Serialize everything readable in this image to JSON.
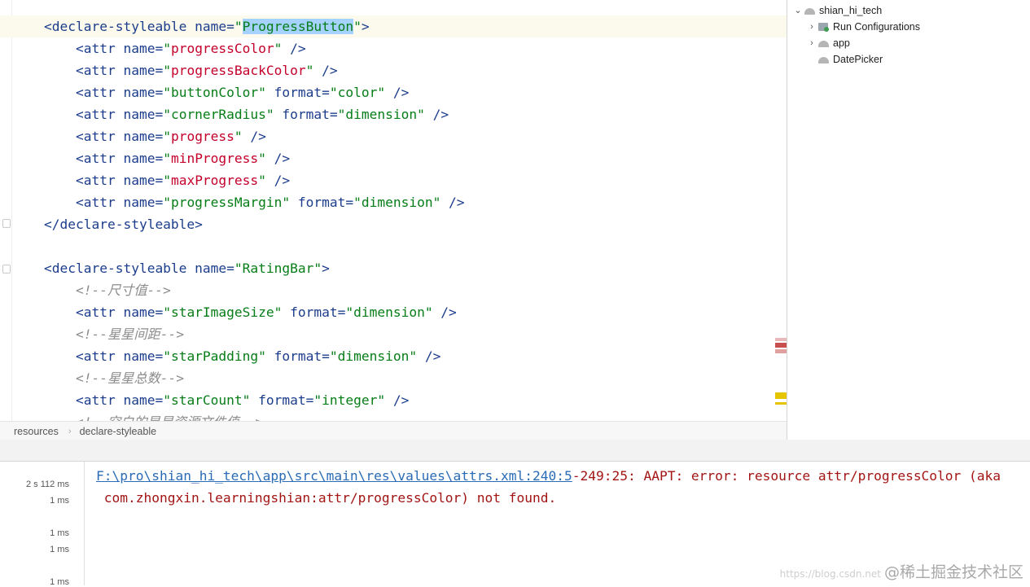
{
  "editor": {
    "lines": [
      {
        "tokens": [
          [
            "tag",
            "<declare-styleable "
          ],
          [
            "attr",
            "name="
          ],
          [
            "val-sel-pre",
            "\""
          ],
          [
            "sel",
            "ProgressButton"
          ],
          [
            "val",
            "\""
          ],
          [
            "tag",
            ">"
          ]
        ]
      },
      {
        "tokens": [
          [
            "tag",
            "    <attr "
          ],
          [
            "attr",
            "name="
          ],
          [
            "val",
            "\""
          ],
          [
            "valr",
            "progressColor"
          ],
          [
            "val",
            "\""
          ],
          [
            "tag",
            " />"
          ]
        ]
      },
      {
        "tokens": [
          [
            "tag",
            "    <attr "
          ],
          [
            "attr",
            "name="
          ],
          [
            "val",
            "\""
          ],
          [
            "valr",
            "progressBackColor"
          ],
          [
            "val",
            "\""
          ],
          [
            "tag",
            " />"
          ]
        ]
      },
      {
        "tokens": [
          [
            "tag",
            "    <attr "
          ],
          [
            "attr",
            "name="
          ],
          [
            "val",
            "\"buttonColor\""
          ],
          [
            "attr",
            " format="
          ],
          [
            "val",
            "\"color\""
          ],
          [
            "tag",
            " />"
          ]
        ]
      },
      {
        "tokens": [
          [
            "tag",
            "    <attr "
          ],
          [
            "attr",
            "name="
          ],
          [
            "val",
            "\"cornerRadius\""
          ],
          [
            "attr",
            " format="
          ],
          [
            "val",
            "\"dimension\""
          ],
          [
            "tag",
            " />"
          ]
        ]
      },
      {
        "tokens": [
          [
            "tag",
            "    <attr "
          ],
          [
            "attr",
            "name="
          ],
          [
            "val",
            "\""
          ],
          [
            "valr",
            "progress"
          ],
          [
            "val",
            "\""
          ],
          [
            "tag",
            " />"
          ]
        ]
      },
      {
        "tokens": [
          [
            "tag",
            "    <attr "
          ],
          [
            "attr",
            "name="
          ],
          [
            "val",
            "\""
          ],
          [
            "valr",
            "minProgress"
          ],
          [
            "val",
            "\""
          ],
          [
            "tag",
            " />"
          ]
        ]
      },
      {
        "tokens": [
          [
            "tag",
            "    <attr "
          ],
          [
            "attr",
            "name="
          ],
          [
            "val",
            "\""
          ],
          [
            "valr",
            "maxProgress"
          ],
          [
            "val",
            "\""
          ],
          [
            "tag",
            " />"
          ]
        ]
      },
      {
        "tokens": [
          [
            "tag",
            "    <attr "
          ],
          [
            "attr",
            "name="
          ],
          [
            "val",
            "\"progressMargin\""
          ],
          [
            "attr",
            " format="
          ],
          [
            "val",
            "\"dimension\""
          ],
          [
            "tag",
            " />"
          ]
        ]
      },
      {
        "tokens": [
          [
            "tag",
            "</declare-styleable>"
          ]
        ]
      },
      {
        "tokens": []
      },
      {
        "tokens": [
          [
            "tag",
            "<declare-styleable "
          ],
          [
            "attr",
            "name="
          ],
          [
            "val",
            "\"RatingBar\""
          ],
          [
            "tag",
            ">"
          ]
        ]
      },
      {
        "tokens": [
          [
            "com",
            "    <!--尺寸值-->"
          ]
        ]
      },
      {
        "tokens": [
          [
            "tag",
            "    <attr "
          ],
          [
            "attr",
            "name="
          ],
          [
            "val",
            "\"starImageSize\""
          ],
          [
            "attr",
            " format="
          ],
          [
            "val",
            "\"dimension\""
          ],
          [
            "tag",
            " />"
          ]
        ]
      },
      {
        "tokens": [
          [
            "com",
            "    <!--星星间距-->"
          ]
        ]
      },
      {
        "tokens": [
          [
            "tag",
            "    <attr "
          ],
          [
            "attr",
            "name="
          ],
          [
            "val",
            "\"starPadding\""
          ],
          [
            "attr",
            " format="
          ],
          [
            "val",
            "\"dimension\""
          ],
          [
            "tag",
            " />"
          ]
        ]
      },
      {
        "tokens": [
          [
            "com",
            "    <!--星星总数-->"
          ]
        ]
      },
      {
        "tokens": [
          [
            "tag",
            "    <attr "
          ],
          [
            "attr",
            "name="
          ],
          [
            "val",
            "\"starCount\""
          ],
          [
            "attr",
            " format="
          ],
          [
            "val",
            "\"integer\""
          ],
          [
            "tag",
            " />"
          ]
        ]
      },
      {
        "tokens": [
          [
            "com",
            "    <!--空白的星星资源文件值-->"
          ]
        ]
      }
    ]
  },
  "breadcrumb": {
    "items": [
      "resources",
      "declare-styleable"
    ],
    "separator": "›"
  },
  "project_tree": {
    "root": "shian_hi_tech",
    "items": [
      {
        "label": "Run Configurations",
        "icon": "run-config-icon"
      },
      {
        "label": "app",
        "icon": "android-module-icon"
      },
      {
        "label": "DatePicker",
        "icon": "android-module-icon"
      }
    ]
  },
  "build_output": {
    "times": [
      "2 s 112 ms",
      "1 ms",
      "1 ms",
      "1 ms",
      "1 ms"
    ],
    "error_link": "F:\\pro\\shian_hi_tech\\app\\src\\main\\res\\values\\attrs.xml:240:5",
    "error_text": "-249:25: AAPT: error: resource attr/progressColor (aka",
    "error_line2": " com.zhongxin.learningshian:attr/progressColor) not found."
  },
  "watermark": {
    "small": "https://blog.csdn.net",
    "main": "@稀土掘金技术社区"
  },
  "colors": {
    "tag": "#1c3d8c",
    "value": "#067d17",
    "unresolved": "#c4002b",
    "comment": "#8c8c8c",
    "selection": "#a6d2ff",
    "error": "#a31515",
    "link": "#2a6bb5"
  }
}
